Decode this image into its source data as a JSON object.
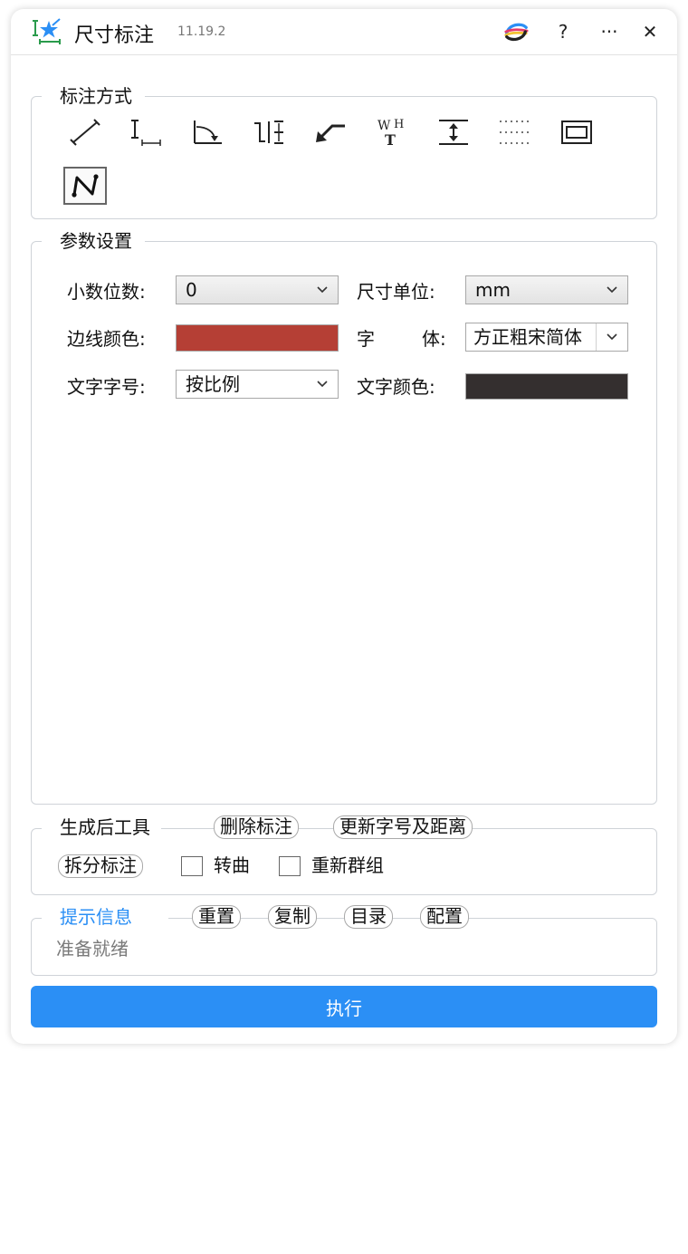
{
  "titlebar": {
    "title": "尺寸标注",
    "version": "11.19.2",
    "help_label": "?",
    "more_label": "···",
    "close_label": "✕"
  },
  "dim_mode": {
    "title": "标注方式",
    "tools": [
      {
        "name": "aligned-dimension-icon"
      },
      {
        "name": "linear-dimension-icon"
      },
      {
        "name": "angular-dimension-icon"
      },
      {
        "name": "vertical-spacing-icon"
      },
      {
        "name": "leader-arrow-icon"
      },
      {
        "name": "width-height-text-icon",
        "text_w": "W",
        "text_h": "H",
        "text_t": "T"
      },
      {
        "name": "spacing-dimension-icon"
      },
      {
        "name": "dotted-grid-icon"
      },
      {
        "name": "frame-icon"
      },
      {
        "name": "polyline-dimension-icon",
        "active": true
      }
    ]
  },
  "params": {
    "title": "参数设置",
    "decimal_label": "小数位数:",
    "decimal_value": "0",
    "unit_label": "尺寸单位:",
    "unit_value": "mm",
    "border_color_label": "边线颜色:",
    "border_color": "#b53f35",
    "font_label_left": "字",
    "font_label_right": "体:",
    "font_value": "方正粗宋简体",
    "text_size_label": "文字字号:",
    "text_size_value": "按比例",
    "text_color_label": "文字颜色:",
    "text_color": "#342f2f"
  },
  "post_tools": {
    "title": "生成后工具",
    "delete_label": "删除标注",
    "update_label": "更新字号及距离",
    "split_label": "拆分标注",
    "curve_label": "转曲",
    "regroup_label": "重新群组"
  },
  "info": {
    "title": "提示信息",
    "title_color": "#2b8ff5",
    "reset_label": "重置",
    "copy_label": "复制",
    "dir_label": "目录",
    "config_label": "配置",
    "status": "准备就绪"
  },
  "execute_label": "执行",
  "colors": {
    "accent": "#2b8ff5"
  }
}
